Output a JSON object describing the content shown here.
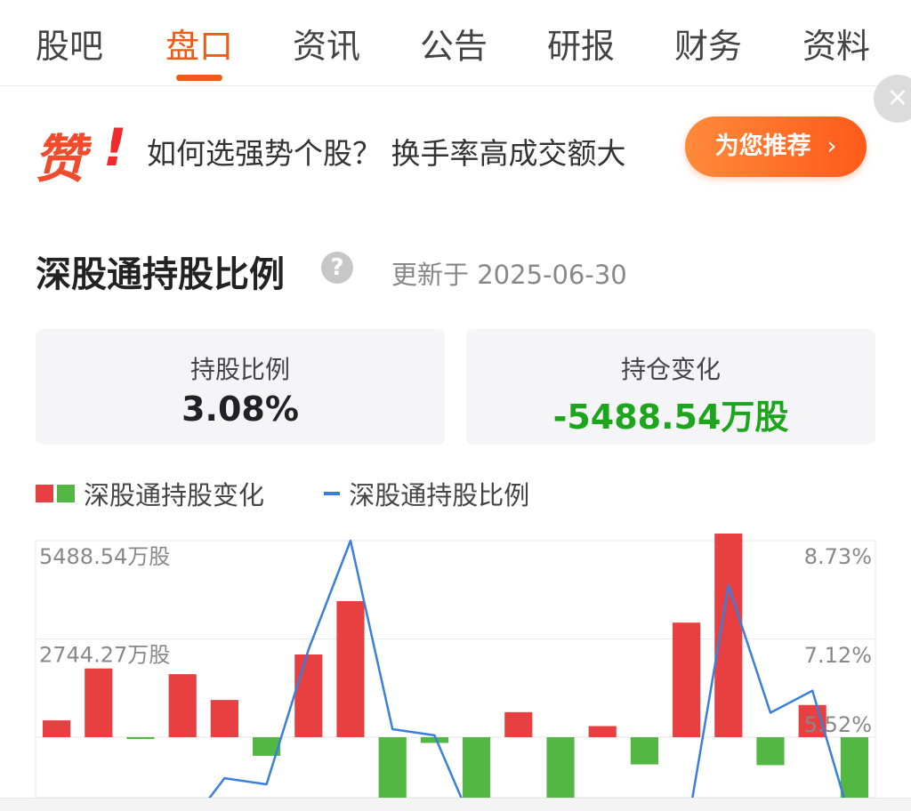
{
  "tabs": [
    {
      "label": "股吧",
      "active": false
    },
    {
      "label": "盘口",
      "active": true
    },
    {
      "label": "资讯",
      "active": false
    },
    {
      "label": "公告",
      "active": false
    },
    {
      "label": "研报",
      "active": false
    },
    {
      "label": "财务",
      "active": false
    },
    {
      "label": "资料",
      "active": false
    }
  ],
  "promo": {
    "badge": "赞",
    "badge_mark": "!",
    "text": "如何选强势个股？ 换手率高成交额大",
    "button_label": "为您推荐",
    "button_chevron": "›",
    "close_glyph": "×"
  },
  "section": {
    "title": "深股通持股比例",
    "help_glyph": "?",
    "updated": "更新于 2025-06-30"
  },
  "stats": {
    "ratio_label": "持股比例",
    "ratio_value": "3.08%",
    "change_label": "持仓变化",
    "change_value": "-5488.54万股"
  },
  "legend": {
    "bar_series": "深股通持股变化",
    "line_series": "深股通持股比例"
  },
  "colors": {
    "accent": "#ef5b14",
    "up_red": "#e84040",
    "down_green": "#52b843",
    "line_blue": "#3b7fdc",
    "change_green": "#1ea51e"
  },
  "chart_data": {
    "type": "bar",
    "left_axis": {
      "labels": [
        "5488.54万股",
        "2744.27万股"
      ],
      "values": [
        5488.54,
        2744.27
      ],
      "range": [
        -2700,
        5488.54
      ]
    },
    "right_axis": {
      "labels": [
        "8.73%",
        "7.12%",
        "5.52%"
      ],
      "values": [
        8.73,
        7.12,
        5.52
      ],
      "range": [
        3.0,
        8.73
      ]
    },
    "series": [
      {
        "name": "深股通持股变化",
        "kind": "bar",
        "values": [
          470,
          1920,
          -50,
          1760,
          1040,
          -520,
          2310,
          3800,
          -2600,
          -160,
          -2600,
          700,
          -1990,
          310,
          -760,
          3200,
          5800,
          -780,
          900,
          -2600
        ]
      },
      {
        "name": "深股通持股比例",
        "kind": "line",
        "values": [
          3.0,
          3.0,
          3.0,
          3.0,
          4.85,
          4.75,
          6.95,
          8.73,
          5.65,
          5.55,
          3.0,
          3.0,
          3.0,
          3.0,
          3.0,
          3.0,
          8.0,
          5.92,
          6.28,
          3.0
        ]
      }
    ],
    "grid": true
  }
}
